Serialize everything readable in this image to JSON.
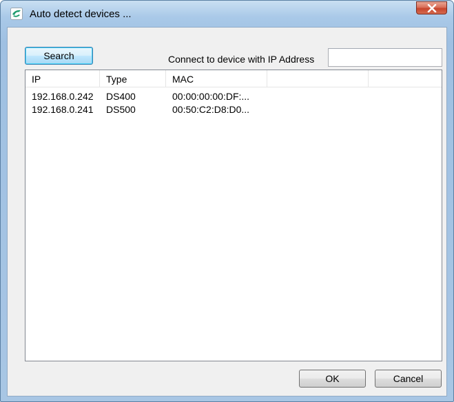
{
  "window": {
    "title": "Auto detect devices ..."
  },
  "search_button": {
    "label": "Search"
  },
  "ip_connect": {
    "label": "Connect to device with IP Address",
    "value": ""
  },
  "device_list": {
    "columns": [
      "IP",
      "Type",
      "MAC",
      "",
      ""
    ],
    "rows": [
      {
        "ip": "192.168.0.242",
        "type": "DS400",
        "mac": "00:00:00:00:DF:..."
      },
      {
        "ip": "192.168.0.241",
        "type": "DS500",
        "mac": "00:50:C2:D8:D0..."
      }
    ]
  },
  "footer": {
    "ok_label": "OK",
    "cancel_label": "Cancel"
  },
  "colors": {
    "frame_accent": "#a9c9e8",
    "close_button": "#c7452d",
    "app_icon": "#1d9a6c"
  },
  "icons": {
    "app": "app-logo-icon",
    "close": "close-icon"
  }
}
